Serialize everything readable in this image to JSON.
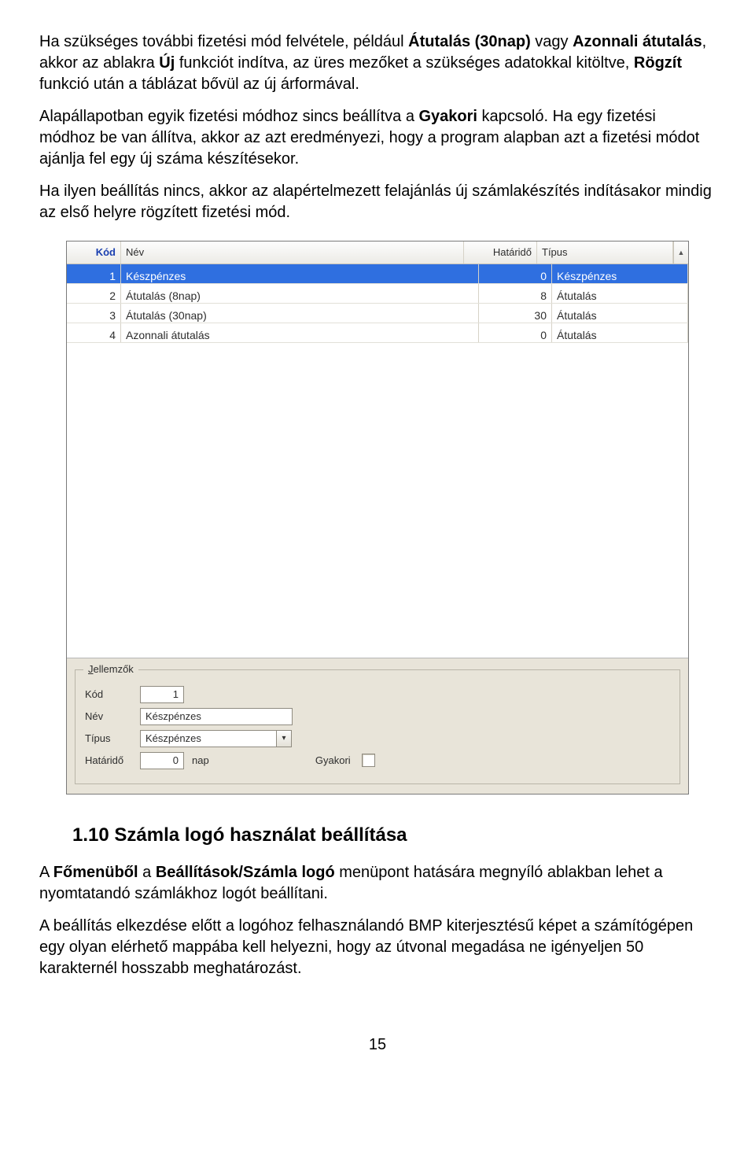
{
  "para1_pre": "Ha szükséges további fizetési mód felvétele, például ",
  "para1_b1": "Átutalás (30nap)",
  "para1_mid1": " vagy ",
  "para1_b2": "Azonnali átutalás",
  "para1_mid2": ", akkor az ablakra ",
  "para1_b3": "Új",
  "para1_mid3": " funkciót indítva, az üres mezőket a szükséges adatokkal kitöltve, ",
  "para1_b4": "Rögzít",
  "para1_post": " funkció után a táblázat bővül az új árformával.",
  "para2_pre": "Alapállapotban egyik fizetési módhoz sincs beállítva a ",
  "para2_b1": "Gyakori",
  "para2_post": " kapcsoló. Ha egy fizetési módhoz be van állítva, akkor az azt eredményezi, hogy a program alapban azt a fizetési módot ajánlja fel egy új száma készítésekor.",
  "para3": "Ha ilyen beállítás nincs, akkor az alapértelmezett felajánlás új számlakészítés indításakor mindig az első helyre rögzített fizetési mód.",
  "table": {
    "headers": {
      "kod": "Kód",
      "nev": "Név",
      "hatarido": "Határidő",
      "tipus": "Típus"
    },
    "rows": [
      {
        "kod": "1",
        "nev": "Készpénzes",
        "hat": "0",
        "tip": "Készpénzes",
        "selected": true
      },
      {
        "kod": "2",
        "nev": "Átutalás (8nap)",
        "hat": "8",
        "tip": "Átutalás",
        "selected": false
      },
      {
        "kod": "3",
        "nev": "Átutalás (30nap)",
        "hat": "30",
        "tip": "Átutalás",
        "selected": false
      },
      {
        "kod": "4",
        "nev": "Azonnali átutalás",
        "hat": "0",
        "tip": "Átutalás",
        "selected": false
      }
    ]
  },
  "panel": {
    "title_u": "J",
    "title_rest": "ellemzők",
    "labels": {
      "kod": "Kód",
      "nev": "Név",
      "tipus": "Típus",
      "hatarido": "Határidő",
      "nap": "nap",
      "gyakori": "Gyakori"
    },
    "values": {
      "kod": "1",
      "nev": "Készpénzes",
      "tipus": "Készpénzes",
      "hatarido": "0"
    }
  },
  "section_heading": "1.10 Számla logó használat beállítása",
  "para4_pre": "A ",
  "para4_b1": "Főmenüből",
  "para4_mid": " a ",
  "para4_b2": "Beállítások/Számla logó",
  "para4_post": " menüpont hatására megnyíló ablakban lehet a nyomtatandó számlákhoz logót beállítani.",
  "para5": "A beállítás elkezdése előtt a logóhoz felhasználandó BMP kiterjesztésű képet a számítógépen egy olyan elérhető mappába kell helyezni, hogy az útvonal megadása ne igényeljen 50 karakternél hosszabb meghatározást.",
  "page_number": "15"
}
